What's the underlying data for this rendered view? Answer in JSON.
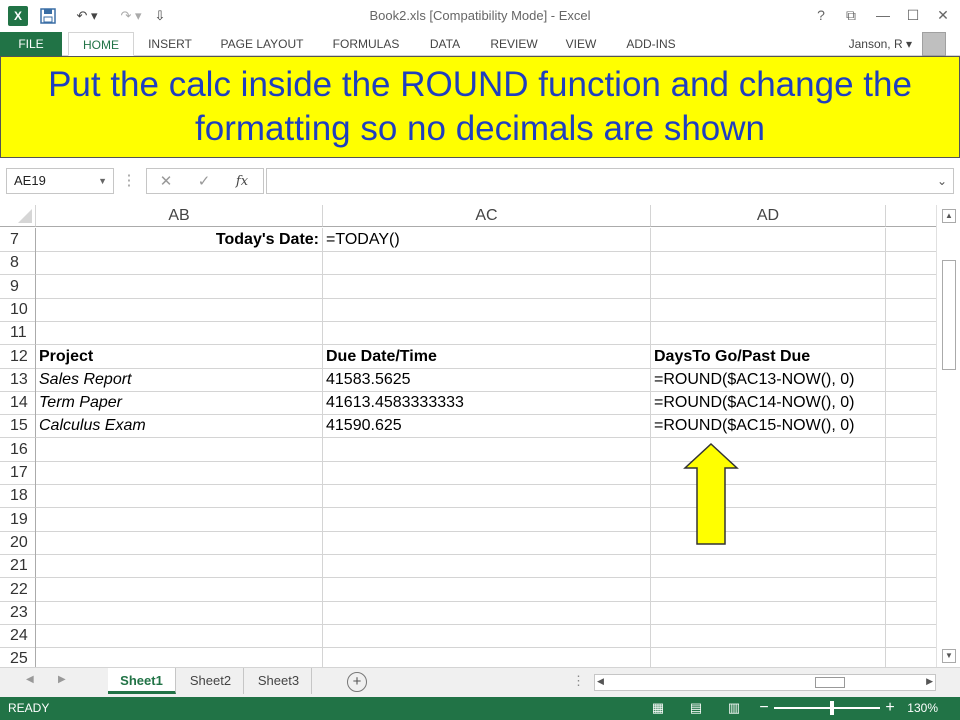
{
  "window": {
    "title": "Book2.xls  [Compatibility Mode] - Excel",
    "logo": "X",
    "user": "Janson, R"
  },
  "ribbon": {
    "tabs": [
      {
        "label": "FILE"
      },
      {
        "label": "HOME"
      },
      {
        "label": "INSERT"
      },
      {
        "label": "PAGE LAYOUT"
      },
      {
        "label": "FORMULAS"
      },
      {
        "label": "DATA"
      },
      {
        "label": "REVIEW"
      },
      {
        "label": "VIEW"
      },
      {
        "label": "ADD-INS"
      }
    ]
  },
  "banner": {
    "text": "Put the calc inside the ROUND function and change the formatting so no decimals are shown",
    "color": "#ffff00",
    "text_color": "#1f3fbf"
  },
  "formula_bar": {
    "name_box": "AE19",
    "fx_label": "fx",
    "content": ""
  },
  "grid": {
    "columns": [
      "AB",
      "AC",
      "AD"
    ],
    "rows": [
      {
        "num": "7",
        "ab": "Today's Date:",
        "ac": "=TODAY()",
        "ad": ""
      },
      {
        "num": "8",
        "ab": "",
        "ac": "",
        "ad": ""
      },
      {
        "num": "9",
        "ab": "",
        "ac": "",
        "ad": ""
      },
      {
        "num": "10",
        "ab": "",
        "ac": "",
        "ad": ""
      },
      {
        "num": "11",
        "ab": "",
        "ac": "",
        "ad": ""
      },
      {
        "num": "12",
        "ab": "Project",
        "ac": "Due Date/Time",
        "ad": "DaysTo Go/Past Due"
      },
      {
        "num": "13",
        "ab": "Sales Report",
        "ac": "41583.5625",
        "ad": "=ROUND($AC13-NOW(), 0)"
      },
      {
        "num": "14",
        "ab": "Term Paper",
        "ac": "41613.4583333333",
        "ad": "=ROUND($AC14-NOW(), 0)"
      },
      {
        "num": "15",
        "ab": "Calculus Exam",
        "ac": "41590.625",
        "ad": "=ROUND($AC15-NOW(), 0)"
      },
      {
        "num": "16",
        "ab": "",
        "ac": "",
        "ad": ""
      },
      {
        "num": "17",
        "ab": "",
        "ac": "",
        "ad": ""
      },
      {
        "num": "18",
        "ab": "",
        "ac": "",
        "ad": ""
      },
      {
        "num": "19",
        "ab": "",
        "ac": "",
        "ad": ""
      },
      {
        "num": "20",
        "ab": "",
        "ac": "",
        "ad": ""
      },
      {
        "num": "21",
        "ab": "",
        "ac": "",
        "ad": ""
      },
      {
        "num": "22",
        "ab": "",
        "ac": "",
        "ad": ""
      },
      {
        "num": "23",
        "ab": "",
        "ac": "",
        "ad": ""
      },
      {
        "num": "24",
        "ab": "",
        "ac": "",
        "ad": ""
      },
      {
        "num": "25",
        "ab": "",
        "ac": "",
        "ad": ""
      }
    ]
  },
  "sheets": {
    "tabs": [
      {
        "label": "Sheet1"
      },
      {
        "label": "Sheet2"
      },
      {
        "label": "Sheet3"
      }
    ],
    "active": "Sheet1"
  },
  "status": {
    "ready": "READY",
    "zoom": "130%"
  },
  "colors": {
    "excel_green": "#217346",
    "arrow": "#ffff00"
  }
}
